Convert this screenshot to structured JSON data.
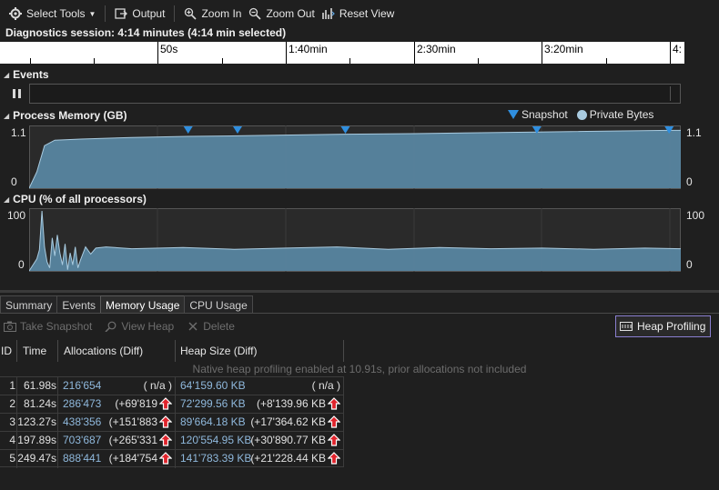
{
  "toolbar": {
    "select_tools": "Select Tools",
    "output": "Output",
    "zoom_in": "Zoom In",
    "zoom_out": "Zoom Out",
    "reset_view": "Reset View"
  },
  "session": {
    "text": "Diagnostics session: 4:14 minutes (4:14 min selected)"
  },
  "ruler": {
    "labels": [
      "50s",
      "1:40min",
      "2:30min",
      "3:20min",
      "4:"
    ]
  },
  "events": {
    "title": "Events"
  },
  "memory": {
    "title": "Process Memory (GB)",
    "legend_snapshot": "Snapshot",
    "legend_private": "Private Bytes",
    "y_max": "1.1",
    "y_min": "0"
  },
  "cpu": {
    "title": "CPU (% of all processors)",
    "y_max": "100",
    "y_min": "0"
  },
  "tabs": [
    "Summary",
    "Events",
    "Memory Usage",
    "CPU Usage"
  ],
  "actions": {
    "take_snapshot": "Take Snapshot",
    "view_heap": "View Heap",
    "delete": "Delete",
    "heap_profiling": "Heap Profiling"
  },
  "table": {
    "headers": {
      "id": "ID",
      "time": "Time",
      "allocations": "Allocations (Diff)",
      "heap": "Heap Size (Diff)"
    },
    "notice": "Native heap profiling enabled at 10.91s, prior allocations not included",
    "rows": [
      {
        "id": "1",
        "time": "61.98s",
        "alloc": "216'654",
        "alloc_diff": "( n/a )",
        "heap": "64'159.60 KB",
        "heap_diff": "( n/a )"
      },
      {
        "id": "2",
        "time": "81.24s",
        "alloc": "286'473",
        "alloc_diff": "(+69'819",
        "heap": "72'299.56 KB",
        "heap_diff": "(+8'139.96 KB"
      },
      {
        "id": "3",
        "time": "123.27s",
        "alloc": "438'356",
        "alloc_diff": "(+151'883",
        "heap": "89'664.18 KB",
        "heap_diff": "(+17'364.62 KB"
      },
      {
        "id": "4",
        "time": "197.89s",
        "alloc": "703'687",
        "alloc_diff": "(+265'331",
        "heap": "120'554.95 KB",
        "heap_diff": "(+30'890.77 KB"
      },
      {
        "id": "5",
        "time": "249.47s",
        "alloc": "888'441",
        "alloc_diff": "(+184'754",
        "heap": "141'783.39 KB",
        "heap_diff": "(+21'228.44 KB"
      }
    ]
  },
  "colors": {
    "accent": "#2f8fe0",
    "chart_fill": "#5a8aa6",
    "chart_line": "#a9cbe0",
    "up_arrow": "#e0242c"
  },
  "chart_data": [
    {
      "type": "area",
      "title": "Process Memory (GB)",
      "ylim": [
        0,
        1.1
      ],
      "x": [
        0,
        3,
        6,
        10,
        20,
        40,
        61.98,
        81.24,
        123.27,
        150,
        197.89,
        249.47,
        254
      ],
      "values": [
        0,
        0.3,
        0.78,
        0.88,
        0.9,
        0.93,
        0.95,
        0.96,
        0.99,
        1.0,
        1.03,
        1.06,
        1.06
      ],
      "snapshots": [
        61.98,
        81.24,
        123.27,
        197.89,
        249.47
      ]
    },
    {
      "type": "area",
      "title": "CPU (% of all processors)",
      "ylim": [
        0,
        100
      ],
      "x": [
        0,
        3,
        4,
        5,
        6,
        7,
        8,
        9,
        10,
        11,
        12,
        13,
        14,
        15,
        16,
        17,
        18,
        19,
        20,
        22,
        24,
        26,
        30,
        40,
        60,
        80,
        100,
        120,
        140,
        160,
        180,
        200,
        220,
        240,
        254
      ],
      "values": [
        0,
        20,
        35,
        100,
        40,
        15,
        5,
        55,
        25,
        60,
        30,
        10,
        45,
        2,
        30,
        10,
        40,
        5,
        18,
        40,
        28,
        38,
        40,
        37,
        39,
        36,
        38,
        40,
        36,
        39,
        37,
        38,
        36,
        38,
        37
      ]
    }
  ]
}
